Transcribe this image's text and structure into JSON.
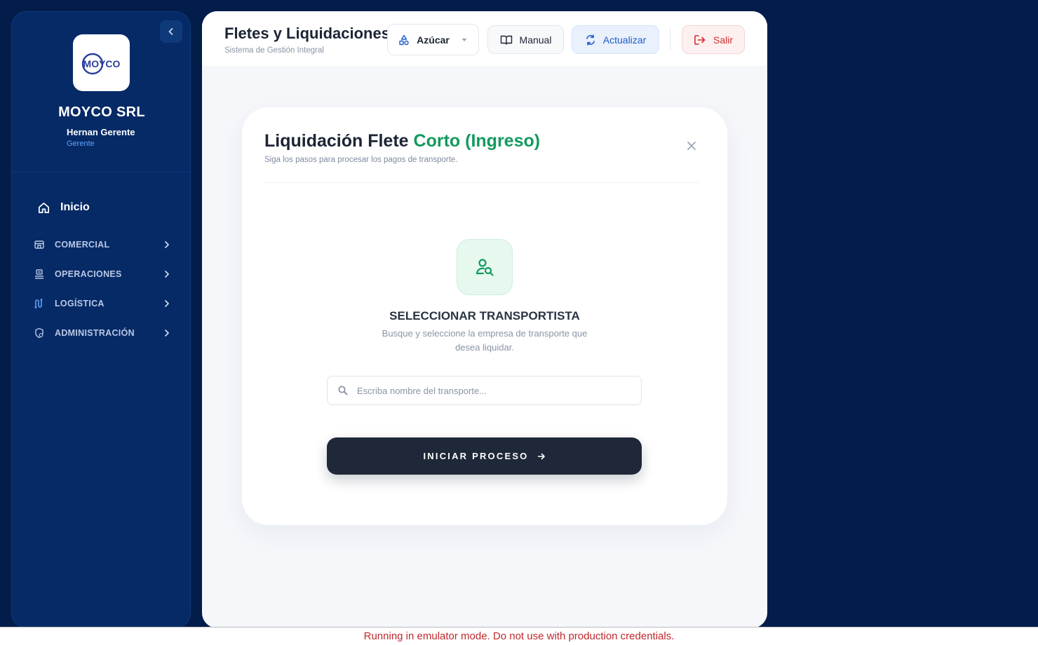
{
  "sidebar": {
    "company": "MOYCO SRL",
    "logo_text": "MOYCO",
    "user_name": "Hernan Gerente",
    "user_role": "Gerente",
    "home_label": "Inicio",
    "items": [
      {
        "label": "COMERCIAL",
        "icon": "store-icon"
      },
      {
        "label": "OPERACIONES",
        "icon": "operations-icon"
      },
      {
        "label": "LOGÍSTICA",
        "icon": "route-icon"
      },
      {
        "label": "ADMINISTRACIÓN",
        "icon": "admin-shield-icon"
      }
    ]
  },
  "header": {
    "title": "Fletes y Liquidaciones",
    "subtitle": "Sistema de Gestión Integral",
    "product_select": "Azúcar",
    "manual_label": "Manual",
    "refresh_label": "Actualizar",
    "logout_label": "Salir"
  },
  "card": {
    "title_main": "Liquidación Flete",
    "title_accent": "Corto (Ingreso)",
    "subtitle": "Siga los pasos para procesar los pagos de transporte.",
    "section_title": "SELECCIONAR TRANSPORTISTA",
    "section_desc": "Busque y seleccione la empresa de transporte que desea liquidar.",
    "search_placeholder": "Escriba nombre del transporte...",
    "search_value": "",
    "start_label": "INICIAR PROCESO"
  },
  "banner": {
    "text": "Running in emulator mode. Do not use with production credentials."
  },
  "colors": {
    "page_bg": "#031d4a",
    "sidebar_bg": "#062a66",
    "accent_green": "#139a5e",
    "accent_blue": "#1f5bc4",
    "danger": "#d12f2f",
    "dark_button": "#1f2838"
  }
}
